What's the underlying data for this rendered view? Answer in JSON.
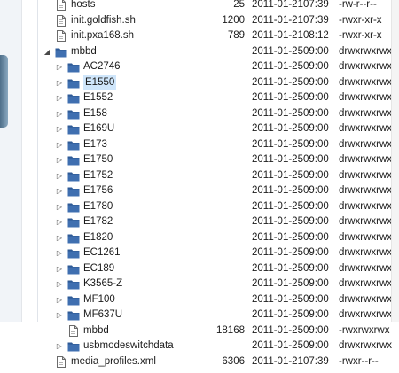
{
  "files": [
    {
      "name": "hosts",
      "size": "25",
      "date": "2011-01-21",
      "time": "07:39",
      "perm": "-rw-r--r--",
      "type": "file",
      "depth": 1
    },
    {
      "name": "init.goldfish.sh",
      "size": "1200",
      "date": "2011-01-21",
      "time": "07:39",
      "perm": "-rwxr-xr-x",
      "type": "file",
      "depth": 1
    },
    {
      "name": "init.pxa168.sh",
      "size": "789",
      "date": "2011-01-21",
      "time": "08:12",
      "perm": "-rwxr-xr-x",
      "type": "file",
      "depth": 1
    },
    {
      "name": "mbbd",
      "size": "",
      "date": "2011-01-25",
      "time": "09:00",
      "perm": "drwxrwxrwx",
      "type": "folder",
      "depth": 1,
      "expanded": true
    },
    {
      "name": "AC2746",
      "size": "",
      "date": "2011-01-25",
      "time": "09:00",
      "perm": "drwxrwxrwx",
      "type": "folder",
      "depth": 2
    },
    {
      "name": "E1550",
      "size": "",
      "date": "2011-01-25",
      "time": "09:00",
      "perm": "drwxrwxrwx",
      "type": "folder",
      "depth": 2,
      "selected": true
    },
    {
      "name": "E1552",
      "size": "",
      "date": "2011-01-25",
      "time": "09:00",
      "perm": "drwxrwxrwx",
      "type": "folder",
      "depth": 2
    },
    {
      "name": "E158",
      "size": "",
      "date": "2011-01-25",
      "time": "09:00",
      "perm": "drwxrwxrwx",
      "type": "folder",
      "depth": 2
    },
    {
      "name": "E169U",
      "size": "",
      "date": "2011-01-25",
      "time": "09:00",
      "perm": "drwxrwxrwx",
      "type": "folder",
      "depth": 2
    },
    {
      "name": "E173",
      "size": "",
      "date": "2011-01-25",
      "time": "09:00",
      "perm": "drwxrwxrwx",
      "type": "folder",
      "depth": 2
    },
    {
      "name": "E1750",
      "size": "",
      "date": "2011-01-25",
      "time": "09:00",
      "perm": "drwxrwxrwx",
      "type": "folder",
      "depth": 2
    },
    {
      "name": "E1752",
      "size": "",
      "date": "2011-01-25",
      "time": "09:00",
      "perm": "drwxrwxrwx",
      "type": "folder",
      "depth": 2
    },
    {
      "name": "E1756",
      "size": "",
      "date": "2011-01-25",
      "time": "09:00",
      "perm": "drwxrwxrwx",
      "type": "folder",
      "depth": 2
    },
    {
      "name": "E1780",
      "size": "",
      "date": "2011-01-25",
      "time": "09:00",
      "perm": "drwxrwxrwx",
      "type": "folder",
      "depth": 2
    },
    {
      "name": "E1782",
      "size": "",
      "date": "2011-01-25",
      "time": "09:00",
      "perm": "drwxrwxrwx",
      "type": "folder",
      "depth": 2
    },
    {
      "name": "E1820",
      "size": "",
      "date": "2011-01-25",
      "time": "09:00",
      "perm": "drwxrwxrwx",
      "type": "folder",
      "depth": 2
    },
    {
      "name": "EC1261",
      "size": "",
      "date": "2011-01-25",
      "time": "09:00",
      "perm": "drwxrwxrwx",
      "type": "folder",
      "depth": 2
    },
    {
      "name": "EC189",
      "size": "",
      "date": "2011-01-25",
      "time": "09:00",
      "perm": "drwxrwxrwx",
      "type": "folder",
      "depth": 2
    },
    {
      "name": "K3565-Z",
      "size": "",
      "date": "2011-01-25",
      "time": "09:00",
      "perm": "drwxrwxrwx",
      "type": "folder",
      "depth": 2
    },
    {
      "name": "MF100",
      "size": "",
      "date": "2011-01-25",
      "time": "09:00",
      "perm": "drwxrwxrwx",
      "type": "folder",
      "depth": 2
    },
    {
      "name": "MF637U",
      "size": "",
      "date": "2011-01-25",
      "time": "09:00",
      "perm": "drwxrwxrwx",
      "type": "folder",
      "depth": 2
    },
    {
      "name": "mbbd",
      "size": "18168",
      "date": "2011-01-25",
      "time": "09:00",
      "perm": "-rwxrwxrwx",
      "type": "file",
      "depth": 2
    },
    {
      "name": "usbmodeswitchdata",
      "size": "",
      "date": "2011-01-25",
      "time": "09:00",
      "perm": "drwxrwxrwx",
      "type": "folder",
      "depth": 2
    },
    {
      "name": "media_profiles.xml",
      "size": "6306",
      "date": "2011-01-21",
      "time": "07:39",
      "perm": "-rwxr--r--",
      "type": "file",
      "depth": 1
    }
  ],
  "colors": {
    "folder": "#3f6fb0",
    "folderTab": "#2e5a96",
    "selected": "#cfe6fb",
    "fileIcon": "#6b6b6b"
  }
}
